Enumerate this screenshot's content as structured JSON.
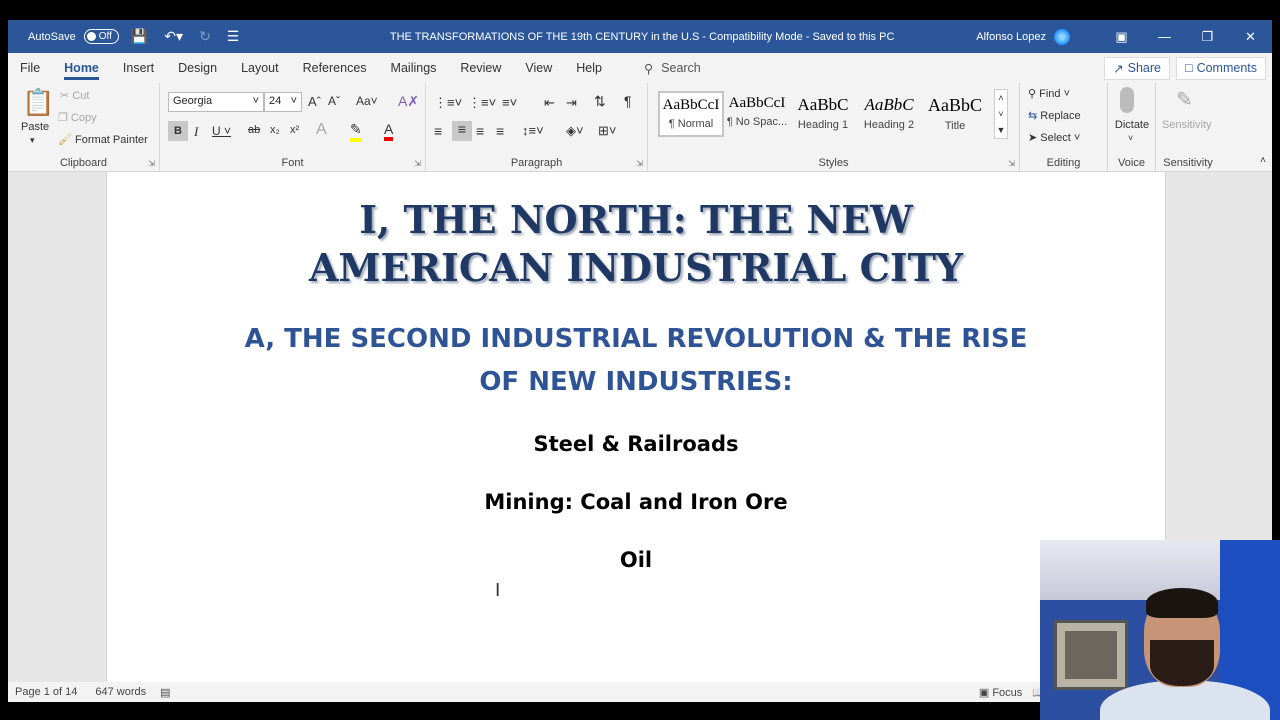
{
  "titlebar": {
    "autosave_label": "AutoSave",
    "autosave_state": "Off",
    "doc_title": "THE TRANSFORMATIONS OF THE 19th CENTURY in the U.S  -  Compatibility Mode  -  Saved to this PC",
    "user": "Alfonso Lopez"
  },
  "menu": {
    "tabs": [
      "File",
      "Home",
      "Insert",
      "Design",
      "Layout",
      "References",
      "Mailings",
      "Review",
      "View",
      "Help"
    ],
    "active": "Home",
    "search_placeholder": "Search",
    "share": "Share",
    "comments": "Comments"
  },
  "ribbon": {
    "clipboard": {
      "paste": "Paste",
      "cut": "Cut",
      "copy": "Copy",
      "format_painter": "Format Painter",
      "label": "Clipboard"
    },
    "font": {
      "name": "Georgia",
      "size": "24",
      "label": "Font"
    },
    "paragraph": {
      "label": "Paragraph"
    },
    "styles": {
      "label": "Styles",
      "items": [
        {
          "sample": "AaBbCcI",
          "name": "¶ Normal"
        },
        {
          "sample": "AaBbCcI",
          "name": "¶ No Spac..."
        },
        {
          "sample": "AaBbC",
          "name": "Heading 1"
        },
        {
          "sample": "AaBbC",
          "name": "Heading 2"
        },
        {
          "sample": "AaBbC",
          "name": "Title"
        }
      ]
    },
    "editing": {
      "find": "Find",
      "replace": "Replace",
      "select": "Select",
      "label": "Editing"
    },
    "voice": {
      "dictate": "Dictate",
      "label": "Voice"
    },
    "sensitivity": {
      "button": "Sensitivity",
      "label": "Sensitivity"
    }
  },
  "document": {
    "heading1_line1": "I, THE NORTH: THE NEW",
    "heading1_line2": "AMERICAN INDUSTRIAL CITY",
    "heading2_line1": "A, THE SECOND INDUSTRIAL REVOLUTION & THE  RISE",
    "heading2_line2": "OF NEW INDUSTRIES:",
    "lines": [
      "Steel & Railroads",
      "Mining: Coal and Iron Ore",
      "Oil"
    ]
  },
  "status": {
    "page": "Page 1 of 14",
    "words": "647 words",
    "focus": "Focus"
  },
  "colors": {
    "brand": "#2b579a",
    "heading1": "#1f3864",
    "heading2": "#2f5496"
  }
}
